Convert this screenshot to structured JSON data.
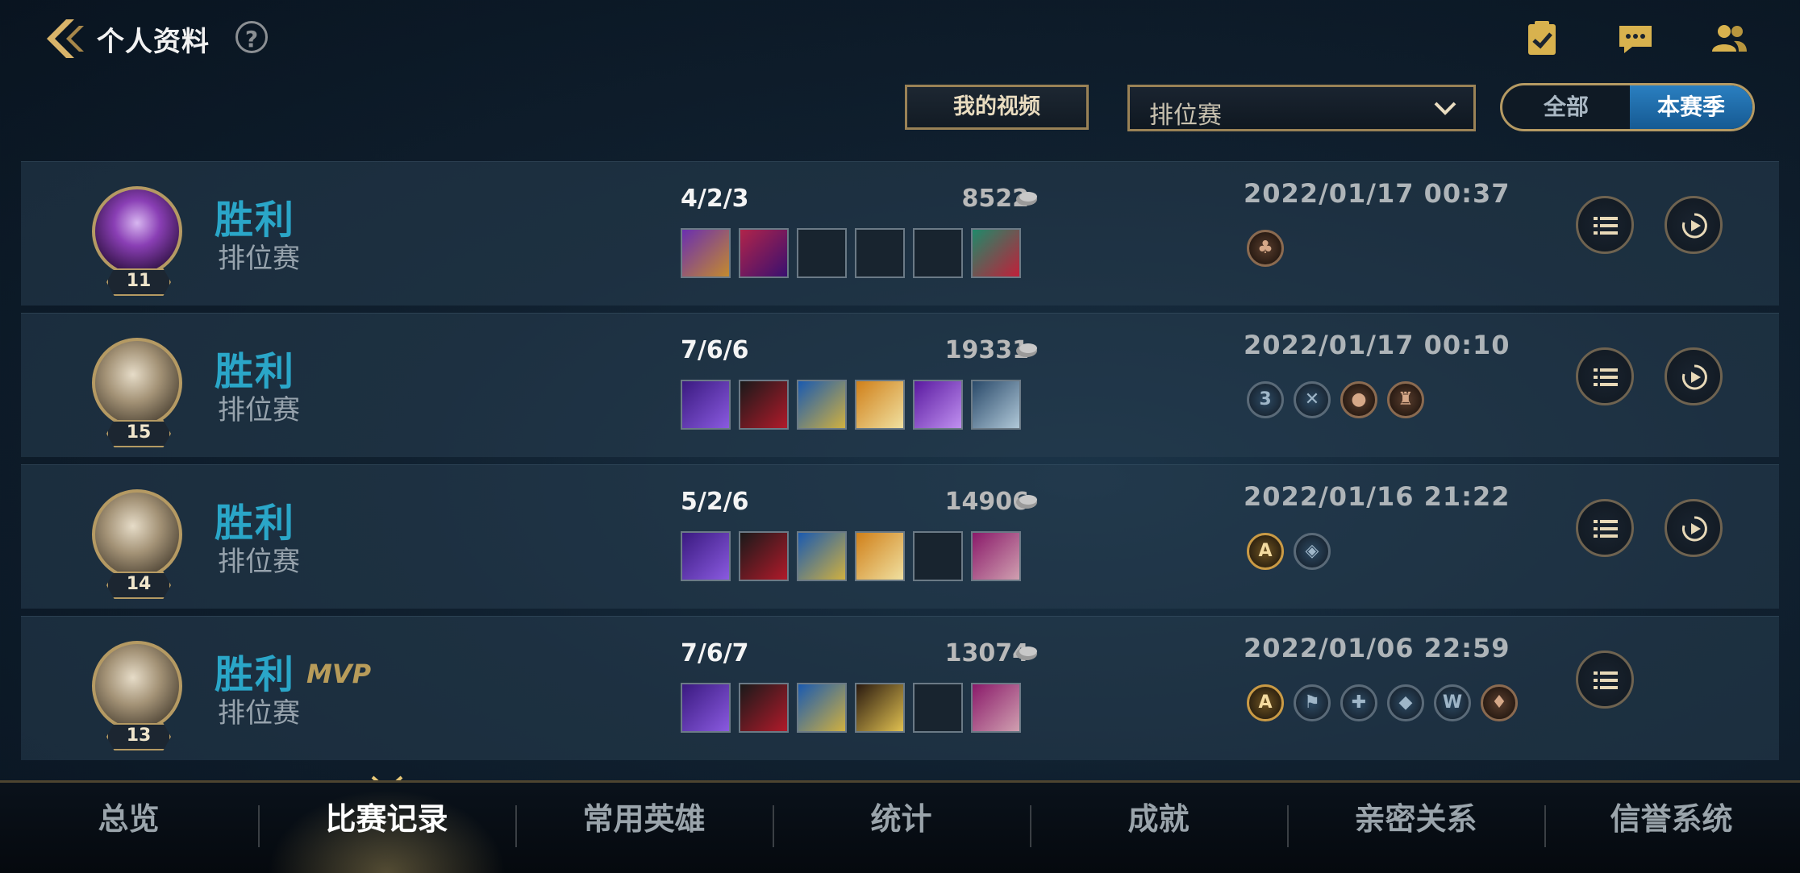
{
  "header": {
    "title": "个人资料",
    "help_glyph": "?",
    "icons": [
      "clipboard-check-icon",
      "chat-bubble-icon",
      "friends-icon"
    ]
  },
  "filters": {
    "video_button": "我的视频",
    "mode_select": "排位赛",
    "scope_toggle": {
      "all": "全部",
      "season": "本赛季",
      "selected": "本赛季"
    }
  },
  "matches": [
    {
      "result": "胜利",
      "mode": "排位赛",
      "level": "11",
      "kda": "4/2/3",
      "gold": "8522",
      "date": "2022/01/17 00:37",
      "mvp": "",
      "items_filled": 3,
      "badges": [
        "bronze-shield"
      ],
      "has_replay": true
    },
    {
      "result": "胜利",
      "mode": "排位赛",
      "level": "15",
      "kda": "7/6/6",
      "gold": "19331",
      "date": "2022/01/17 00:10",
      "mvp": "",
      "items_filled": 6,
      "badges": [
        "triple-kill",
        "no-death",
        "gold",
        "tower"
      ],
      "has_replay": true
    },
    {
      "result": "胜利",
      "mode": "排位赛",
      "level": "14",
      "kda": "5/2/6",
      "gold": "14906",
      "date": "2022/01/16 21:22",
      "mvp": "",
      "items_filled": 5,
      "badges": [
        "grade-a",
        "shield"
      ],
      "has_replay": true
    },
    {
      "result": "胜利",
      "mode": "排位赛",
      "level": "13",
      "kda": "7/6/7",
      "gold": "13074",
      "date": "2022/01/06 22:59",
      "mvp": "MVP",
      "items_filled": 5,
      "badges": [
        "grade-a",
        "flag",
        "heal",
        "defense",
        "vision",
        "blood"
      ],
      "has_replay": false
    }
  ],
  "nav": {
    "tabs": [
      "总览",
      "比赛记录",
      "常用英雄",
      "统计",
      "成就",
      "亲密关系",
      "信誉系统"
    ],
    "active": "比赛记录"
  },
  "colors": {
    "win": "#2aa6c8",
    "accent_gold": "#b59a63",
    "toggle_active": "#2a7fc0"
  }
}
